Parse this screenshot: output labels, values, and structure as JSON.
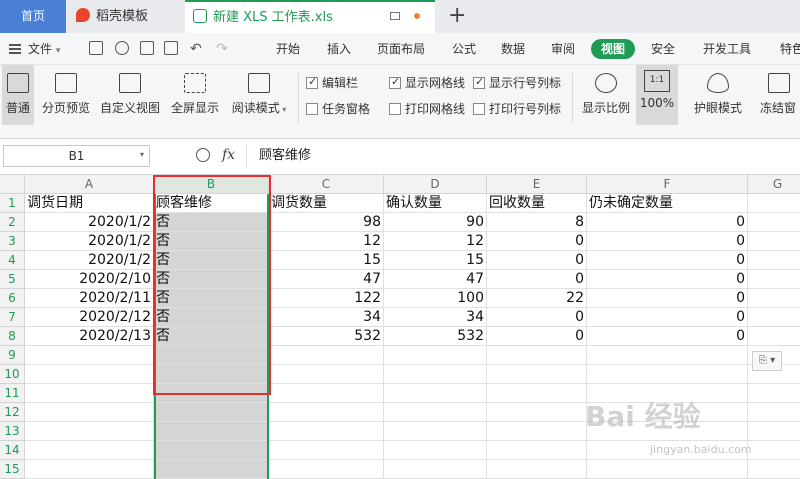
{
  "tabs": {
    "home": "首页",
    "template": "稻壳模板",
    "active_file": "新建 XLS 工作表.xls",
    "new_tab": "+"
  },
  "menubar": {
    "file": "文件",
    "file_arrow": "▾",
    "items": [
      "开始",
      "插入",
      "页面布局",
      "公式",
      "数据",
      "审阅",
      "视图",
      "安全",
      "开发工具",
      "特色"
    ],
    "active": "视图"
  },
  "toolbar": {
    "normal": "普通",
    "page_preview": "分页预览",
    "custom_view": "自定义视图",
    "fullscreen": "全屏显示",
    "reading_mode": "阅读模式",
    "checkboxes": [
      {
        "label": "编辑栏",
        "checked": true
      },
      {
        "label": "任务窗格",
        "checked": false
      },
      {
        "label": "显示网格线",
        "checked": true
      },
      {
        "label": "打印网格线",
        "checked": false
      },
      {
        "label": "显示行号列标",
        "checked": true
      },
      {
        "label": "打印行号列标",
        "checked": false
      }
    ],
    "zoom_ratio": "显示比例",
    "zoom_box": "1:1",
    "zoom_percent": "100%",
    "eye_mode": "护眼模式",
    "freeze": "冻结窗"
  },
  "formula_bar": {
    "name_box": "B1",
    "fx": "fx",
    "content": "顾客维修"
  },
  "grid": {
    "columns": [
      "A",
      "B",
      "C",
      "D",
      "E",
      "F",
      "G"
    ],
    "rows": [
      "1",
      "2",
      "3",
      "4",
      "5",
      "6",
      "7",
      "8",
      "9",
      "10",
      "11",
      "12",
      "13",
      "14",
      "15"
    ],
    "headers": [
      "调货日期",
      "顾客维修",
      "调货数量",
      "确认数量",
      "回收数量",
      "仍未确定数量"
    ],
    "data": [
      [
        "2020/1/2",
        "否",
        "98",
        "90",
        "8",
        "0"
      ],
      [
        "2020/1/2",
        "否",
        "12",
        "12",
        "0",
        "0"
      ],
      [
        "2020/1/2",
        "否",
        "15",
        "15",
        "0",
        "0"
      ],
      [
        "2020/2/10",
        "否",
        "47",
        "47",
        "0",
        "0"
      ],
      [
        "2020/2/11",
        "否",
        "122",
        "100",
        "22",
        "0"
      ],
      [
        "2020/2/12",
        "否",
        "34",
        "34",
        "0",
        "0"
      ],
      [
        "2020/2/13",
        "否",
        "532",
        "532",
        "0",
        "0"
      ]
    ]
  },
  "watermark": {
    "main": "Bai 经验",
    "sub": "jingyan.baidu.com"
  },
  "colors": {
    "accent": "#1e9b55",
    "highlight_box": "#e03030",
    "selected_column": "#d5d5d5"
  }
}
